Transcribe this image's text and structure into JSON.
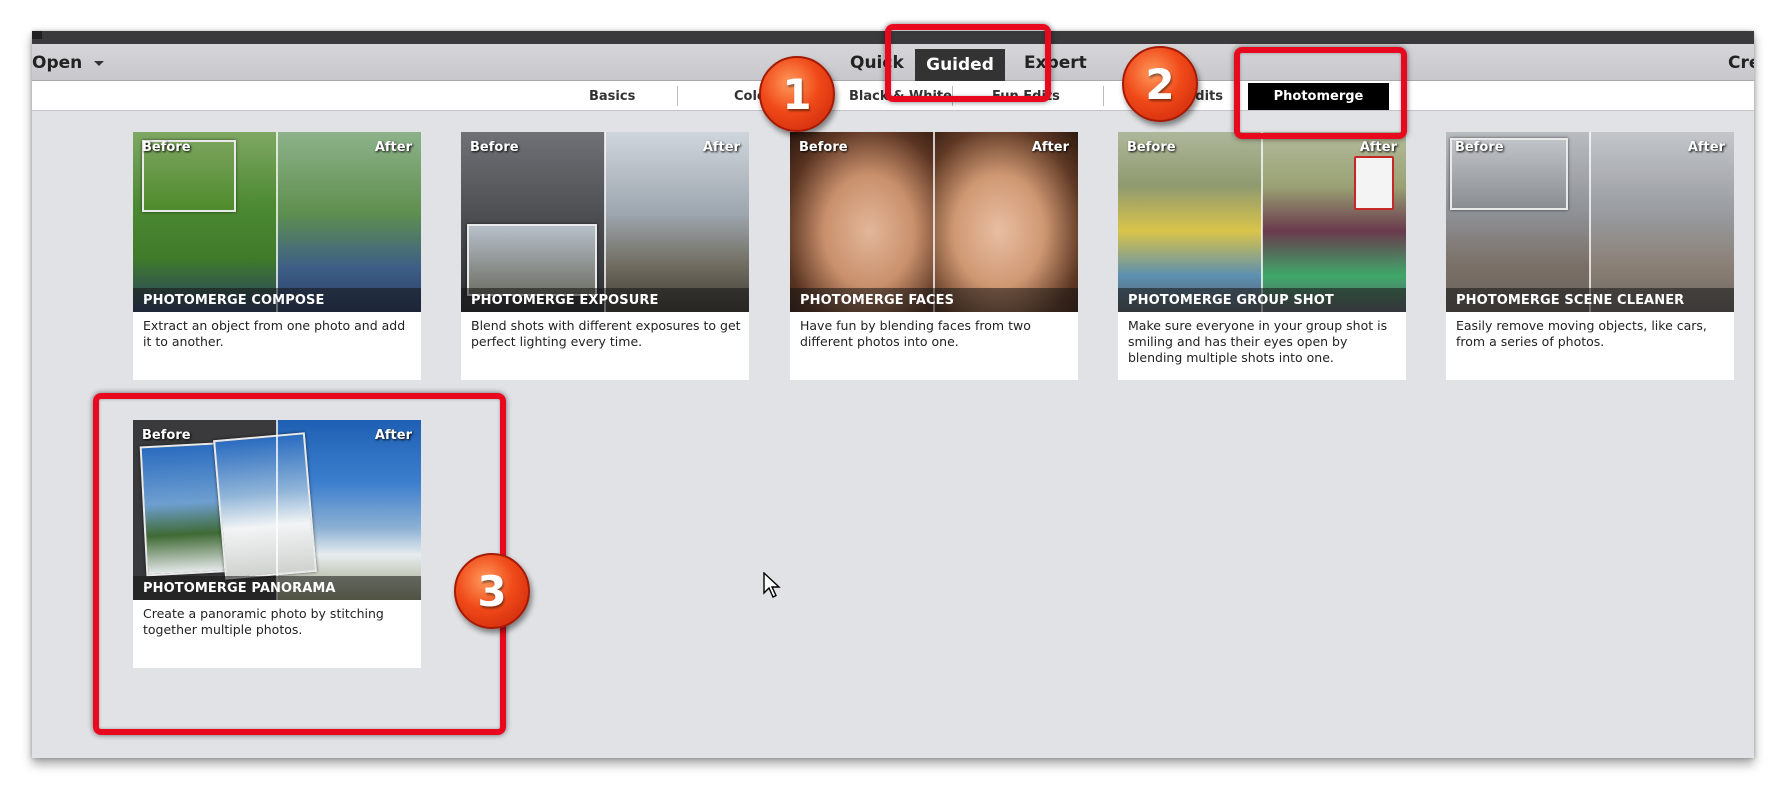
{
  "menubar": {
    "open_label": "Open",
    "modes": {
      "quick": "Quick",
      "guided": "Guided",
      "expert": "Expert"
    },
    "create_label": "Create"
  },
  "subtabs": {
    "basics": "Basics",
    "color": "Color",
    "black_white": "Black & White",
    "fun_edits": "Fun Edits",
    "special_edits": "Special Edits",
    "photomerge": "Photomerge"
  },
  "cards": [
    {
      "title": "PHOTOMERGE COMPOSE",
      "desc": "Extract an object from one photo and add it to another.",
      "before": "Before",
      "after": "After"
    },
    {
      "title": "PHOTOMERGE EXPOSURE",
      "desc": "Blend shots with different exposures to get perfect lighting every time.",
      "before": "Before",
      "after": "After"
    },
    {
      "title": "PHOTOMERGE FACES",
      "desc": "Have fun by blending faces from two different photos into one.",
      "before": "Before",
      "after": "After"
    },
    {
      "title": "PHOTOMERGE GROUP SHOT",
      "desc": "Make sure everyone in your group shot is smiling and has their eyes open by blending multiple shots into one.",
      "before": "Before",
      "after": "After"
    },
    {
      "title": "PHOTOMERGE SCENE CLEANER",
      "desc": "Easily remove moving objects, like cars, from a series of photos.",
      "before": "Before",
      "after": "After"
    },
    {
      "title": "PHOTOMERGE PANORAMA",
      "desc": "Create a panoramic photo by stitching together multiple photos.",
      "before": "Before",
      "after": "After"
    }
  ],
  "badges": {
    "one": "1",
    "two": "2",
    "three": "3"
  },
  "colors": {
    "highlight": "#e8091e",
    "badge": "#f04a19",
    "workspace": "#e1e2e5"
  }
}
